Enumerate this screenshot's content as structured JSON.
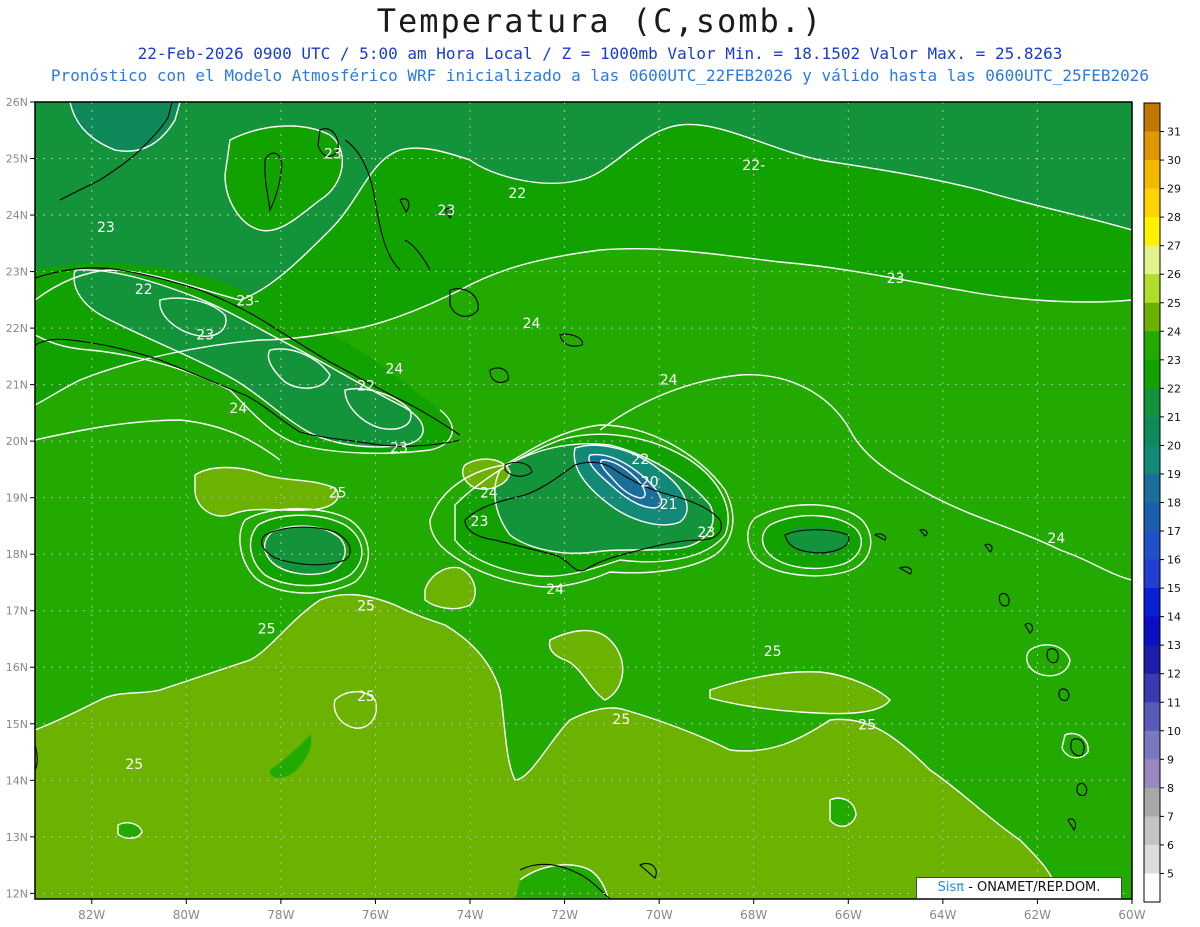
{
  "header": {
    "title": "Temperatura (C,somb.)",
    "line1": "22-Feb-2026  0900 UTC / 5:00 am Hora Local / Z = 1000mb   Valor Min. = 18.1502  Valor Max. = 25.8263",
    "line2": "Pronóstico con el Modelo Atmosférico WRF inicializado a las 0600UTC_22FEB2026 y válido hasta las  0600UTC_25FEB2026"
  },
  "axes": {
    "lon_labels": [
      "82W",
      "80W",
      "78W",
      "76W",
      "74W",
      "72W",
      "70W",
      "68W",
      "66W",
      "64W",
      "62W",
      "60W"
    ],
    "lat_labels": [
      "26N",
      "25N",
      "24N",
      "23N",
      "22N",
      "21N",
      "20N",
      "19N",
      "18N",
      "17N",
      "16N",
      "15N",
      "14N",
      "13N",
      "12N"
    ],
    "lon_range": [
      -83.2,
      -60
    ],
    "lat_range": [
      11.9,
      26
    ]
  },
  "colorbar": {
    "labels": [
      "31",
      "30",
      "29",
      "28",
      "27",
      "26",
      "25",
      "24",
      "23",
      "22",
      "21",
      "20",
      "19",
      "18",
      "17",
      "16",
      "15",
      "14",
      "13",
      "12",
      "11",
      "10",
      "9",
      "8",
      "7",
      "6",
      "5"
    ],
    "colors": [
      "#c07800",
      "#e09800",
      "#f5b800",
      "#ffd400",
      "#fff200",
      "#e4f28c",
      "#b0dc2a",
      "#6cb200",
      "#22aa00",
      "#12a200",
      "#14943a",
      "#0e8a5a",
      "#138a78",
      "#1a6f9a",
      "#1a5fb0",
      "#1f50c8",
      "#1f3ecf",
      "#0a1ed4",
      "#0a10c0",
      "#1c1ca8",
      "#3a3ab0",
      "#5a5ab8",
      "#7a78c0",
      "#9a88c0",
      "#a8a8a8",
      "#c4c4c4",
      "#dcdcdc",
      "#ffffff"
    ]
  },
  "contour_labels": [
    {
      "text": "23",
      "lon": -76.9,
      "lat": 25.0
    },
    {
      "text": "22",
      "lon": -73.0,
      "lat": 24.3
    },
    {
      "text": "22-",
      "lon": -68.0,
      "lat": 24.8
    },
    {
      "text": "23",
      "lon": -74.5,
      "lat": 24.0
    },
    {
      "text": "23",
      "lon": -81.7,
      "lat": 23.7
    },
    {
      "text": "23",
      "lon": -65.0,
      "lat": 22.8
    },
    {
      "text": "22",
      "lon": -80.9,
      "lat": 22.6
    },
    {
      "text": "23-",
      "lon": -78.7,
      "lat": 22.4
    },
    {
      "text": "23",
      "lon": -79.6,
      "lat": 21.8
    },
    {
      "text": "24",
      "lon": -72.7,
      "lat": 22.0
    },
    {
      "text": "24",
      "lon": -75.6,
      "lat": 21.2
    },
    {
      "text": "22",
      "lon": -76.2,
      "lat": 20.9
    },
    {
      "text": "24",
      "lon": -69.8,
      "lat": 21.0
    },
    {
      "text": "24",
      "lon": -78.9,
      "lat": 20.5
    },
    {
      "text": "23",
      "lon": -75.5,
      "lat": 19.8
    },
    {
      "text": "22",
      "lon": -70.4,
      "lat": 19.6
    },
    {
      "text": "20",
      "lon": -70.2,
      "lat": 19.2
    },
    {
      "text": "25",
      "lon": -76.8,
      "lat": 19.0
    },
    {
      "text": "24",
      "lon": -73.6,
      "lat": 19.0
    },
    {
      "text": "21",
      "lon": -69.8,
      "lat": 18.8
    },
    {
      "text": "23",
      "lon": -73.8,
      "lat": 18.5
    },
    {
      "text": "23",
      "lon": -69.0,
      "lat": 18.3
    },
    {
      "text": "24",
      "lon": -61.6,
      "lat": 18.2
    },
    {
      "text": "24",
      "lon": -72.2,
      "lat": 17.3
    },
    {
      "text": "25",
      "lon": -76.2,
      "lat": 17.0
    },
    {
      "text": "25",
      "lon": -78.3,
      "lat": 16.6
    },
    {
      "text": "25",
      "lon": -67.6,
      "lat": 16.2
    },
    {
      "text": "25",
      "lon": -76.2,
      "lat": 15.4
    },
    {
      "text": "25",
      "lon": -70.8,
      "lat": 15.0
    },
    {
      "text": "25",
      "lon": -65.6,
      "lat": 14.9
    },
    {
      "text": "25",
      "lon": -81.1,
      "lat": 14.2
    }
  ],
  "credit": {
    "sis": "Sisπ",
    "text": " - ONAMET/REP.DOM."
  }
}
